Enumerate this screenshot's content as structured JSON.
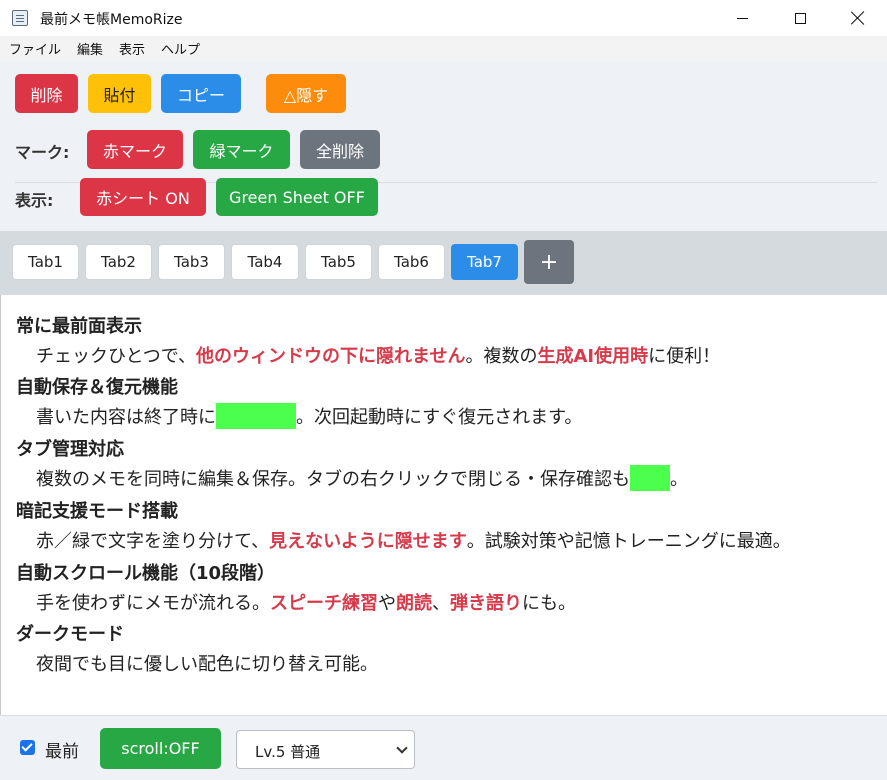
{
  "window": {
    "title": "最前メモ帳MemoRize",
    "app_icon": "notepad-icon",
    "controls": {
      "minimize": "minimize-icon",
      "maximize": "maximize-icon",
      "close": "close-icon"
    }
  },
  "menu": {
    "items": [
      "ファイル",
      "編集",
      "表示",
      "ヘルプ"
    ]
  },
  "toolbar": {
    "delete_label": "削除",
    "paste_label": "貼付",
    "copy_label": "コピー",
    "hide_label": "△隠す",
    "mark_label": "マーク:",
    "red_mark_label": "赤マーク",
    "green_mark_label": "緑マーク",
    "clear_all_label": "全削除",
    "display_label": "表示:",
    "red_sheet_label": "赤シート ON",
    "green_sheet_label": "Green Sheet OFF"
  },
  "colors": {
    "red": "#dc3545",
    "yellow": "#ffc107",
    "blue": "#2b8de8",
    "orange": "#fd8c0d",
    "green": "#28a745",
    "gray": "#6c757d",
    "highlight_red": "#d63b4b",
    "mask_green": "#4dff4d"
  },
  "tabs": {
    "items": [
      "Tab1",
      "Tab2",
      "Tab3",
      "Tab4",
      "Tab5",
      "Tab6",
      "Tab7"
    ],
    "active": "Tab7",
    "add_label": "+"
  },
  "content": {
    "f1_title": "常に最前面表示",
    "f1_a": "チェックひとつで、",
    "f1_b": "他のウィンドウの下に隠れません",
    "f1_c": "。複数の",
    "f1_d": "生成AI使用時",
    "f1_e": "に便利！",
    "f2_title": "自動保存＆復元機能",
    "f2_a": "書いた内容は終了時に",
    "f2_b": "。次回起動時にすぐ復元されます。",
    "f3_title": "タブ管理対応",
    "f3_a": "複数のメモを同時に編集＆保存。タブの右クリックで閉じる・保存確認も",
    "f3_b": "。",
    "f4_title": "暗記支援モード搭載",
    "f4_a": "赤／緑で文字を塗り分けて、",
    "f4_b": "見えないように隠せます",
    "f4_c": "。試験対策や記憶トレーニングに最適。",
    "f5_title": "自動スクロール機能（10段階）",
    "f5_a": "手を使わずにメモが流れる。",
    "f5_b": "スピーチ練習",
    "f5_c": "や",
    "f5_d": "朗読",
    "f5_e": "、",
    "f5_f": "弾き語り",
    "f5_g": "にも。",
    "f6_title": "ダークモード",
    "f6_a": "夜間でも目に優しい配色に切り替え可能。"
  },
  "status": {
    "topmost_label": "最前",
    "topmost_checked": true,
    "scroll_label": "scroll:OFF",
    "level_value": "Lv.5 普通"
  }
}
